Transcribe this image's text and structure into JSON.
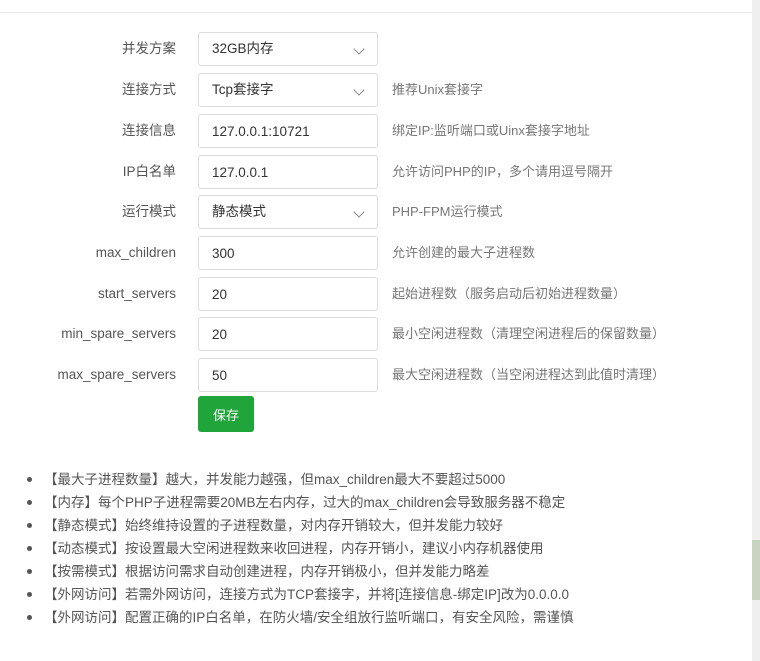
{
  "form": {
    "rows": [
      {
        "label": "并发方案",
        "type": "select",
        "value": "32GB内存",
        "hint": ""
      },
      {
        "label": "连接方式",
        "type": "select",
        "value": "Tcp套接字",
        "hint": "推荐Unix套接字"
      },
      {
        "label": "连接信息",
        "type": "input",
        "value": "127.0.0.1:10721",
        "hint": "绑定IP:监听端口或Uinx套接字地址"
      },
      {
        "label": "IP白名单",
        "type": "input",
        "value": "127.0.0.1",
        "hint": "允许访问PHP的IP，多个请用逗号隔开"
      },
      {
        "label": "运行模式",
        "type": "select",
        "value": "静态模式",
        "hint": "PHP-FPM运行模式"
      },
      {
        "label": "max_children",
        "type": "input",
        "value": "300",
        "hint": "允许创建的最大子进程数"
      },
      {
        "label": "start_servers",
        "type": "input",
        "value": "20",
        "hint": "起始进程数（服务启动后初始进程数量）"
      },
      {
        "label": "min_spare_servers",
        "type": "input",
        "value": "20",
        "hint": "最小空闲进程数（清理空闲进程后的保留数量）"
      },
      {
        "label": "max_spare_servers",
        "type": "input",
        "value": "50",
        "hint": "最大空闲进程数（当空闲进程达到此值时清理）"
      }
    ],
    "save_label": "保存"
  },
  "tips": [
    "【最大子进程数量】越大，并发能力越强，但max_children最大不要超过5000",
    "【内存】每个PHP子进程需要20MB左右内存，过大的max_children会导致服务器不稳定",
    "【静态模式】始终维持设置的子进程数量，对内存开销较大，但并发能力较好",
    "【动态模式】按设置最大空闲进程数来收回进程，内存开销小，建议小内存机器使用",
    "【按需模式】根据访问需求自动创建进程，内存开销极小，但并发能力略差",
    "【外网访问】若需外网访问，连接方式为TCP套接字，并将[连接信息-绑定IP]改为0.0.0.0",
    "【外网访问】配置正确的IP白名单，在防火墙/安全组放行监听端口，有安全风险，需谨慎"
  ],
  "colors": {
    "accent": "#20a53a",
    "border": "#dcdcdc",
    "text": "#555555",
    "hint": "#777777"
  },
  "icons": {
    "select_arrow": "chevron-down-icon",
    "bullet": "bullet-dot-icon"
  }
}
